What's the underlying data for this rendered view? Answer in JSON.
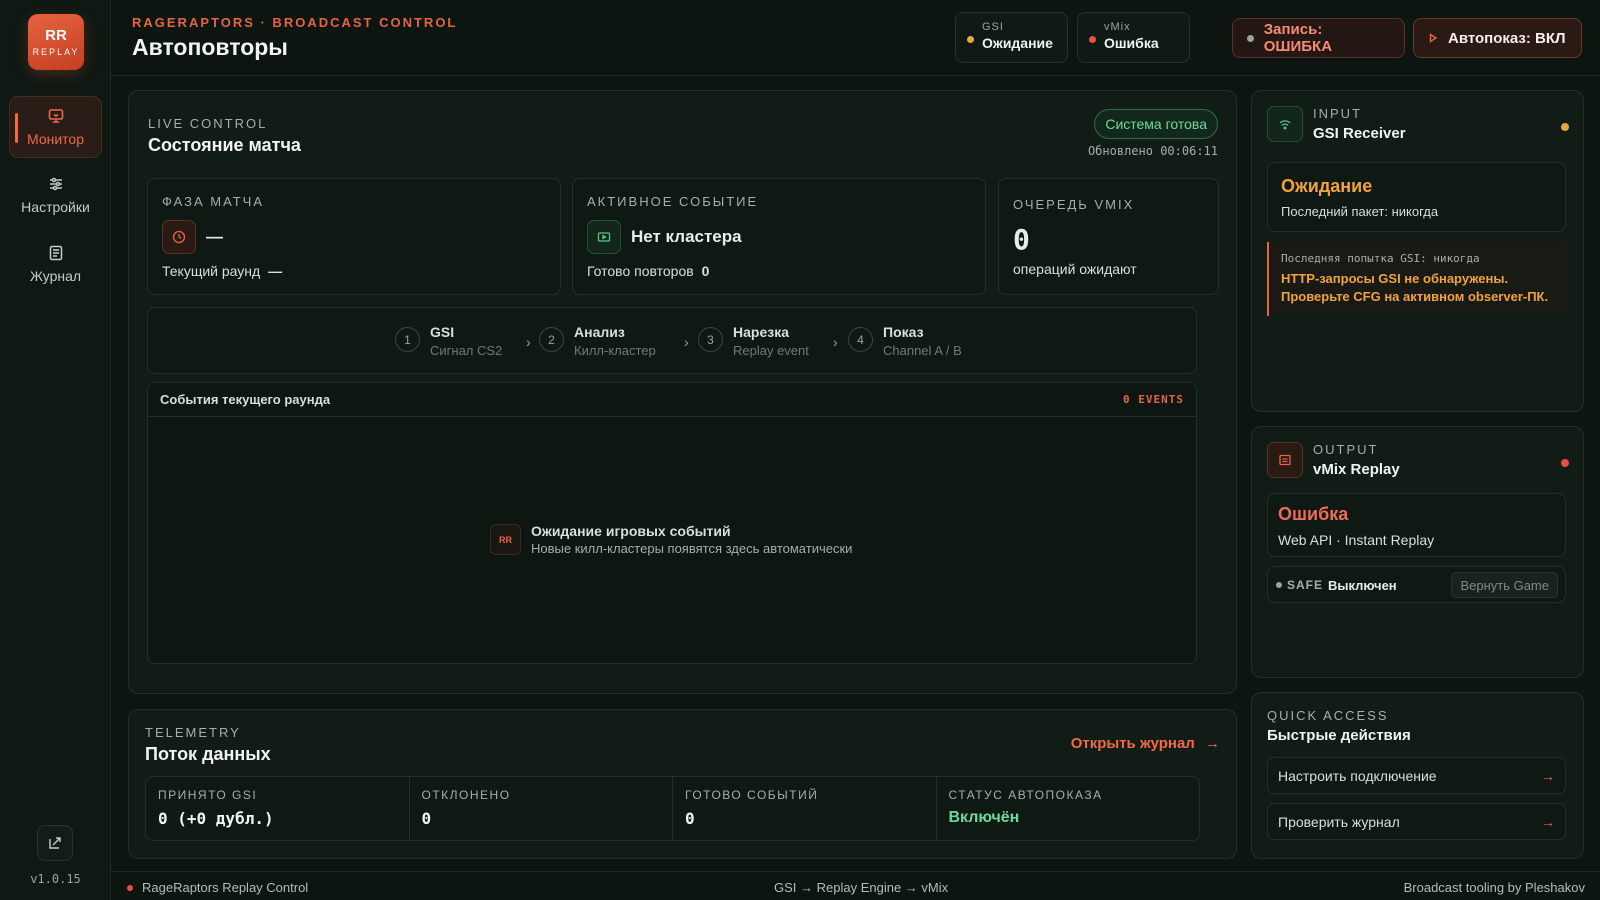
{
  "sidebar": {
    "logo_top": "RR",
    "logo_bottom": "REPLAY",
    "items": [
      {
        "label": "Монитор",
        "icon": "monitor-icon"
      },
      {
        "label": "Настройки",
        "icon": "sliders-icon"
      },
      {
        "label": "Журнал",
        "icon": "journal-icon"
      }
    ],
    "version": "v1.0.15"
  },
  "header": {
    "brand": "RAGERAPTORS · BROADCAST CONTROL",
    "title": "Автоповторы",
    "gsi": {
      "label": "GSI",
      "value": "Ожидание",
      "color": "#e8a840"
    },
    "vmix": {
      "label": "vMix",
      "value": "Ошибка",
      "color": "#e8503f"
    },
    "record_button": "Запись: ОШИБКА",
    "autoplay_button": "Автопоказ: ВКЛ"
  },
  "live": {
    "eyebrow": "LIVE CONTROL",
    "title": "Состояние матча",
    "badge": "Система готова",
    "updated": "Обновлено 00:06:11",
    "phase": {
      "label": "ФАЗА МАТЧА",
      "value": "—",
      "round_label": "Текущий раунд",
      "round_value": "—"
    },
    "active_event": {
      "label": "АКТИВНОЕ СОБЫТИЕ",
      "value": "Нет кластера",
      "ready_label": "Готово повторов",
      "ready_value": "0"
    },
    "queue": {
      "label": "ОЧЕРЕДЬ VMIX",
      "value": "0",
      "sub": "операций ожидают"
    },
    "pipeline": [
      {
        "num": "1",
        "title": "GSI",
        "sub": "Сигнал CS2"
      },
      {
        "num": "2",
        "title": "Анализ",
        "sub": "Килл-кластер"
      },
      {
        "num": "3",
        "title": "Нарезка",
        "sub": "Replay event"
      },
      {
        "num": "4",
        "title": "Показ",
        "sub": "Channel A / B"
      }
    ],
    "arrow": "›",
    "events": {
      "title": "События текущего раунда",
      "count": "0 EVENTS",
      "empty_badge": "RR",
      "empty_title": "Ожидание игровых событий",
      "empty_sub": "Новые килл-кластеры появятся здесь автоматически"
    }
  },
  "telemetry": {
    "eyebrow": "TELEMETRY",
    "title": "Поток данных",
    "open_log": "Открыть журнал",
    "metrics": [
      {
        "label": "ПРИНЯТО GSI",
        "value": "0 (+0 дубл.)"
      },
      {
        "label": "ОТКЛОНЕНО",
        "value": "0"
      },
      {
        "label": "ГОТОВО СОБЫТИЙ",
        "value": "0"
      },
      {
        "label": "СТАТУС АВТОПОКАЗА",
        "value": "Включён"
      }
    ]
  },
  "input": {
    "eyebrow": "INPUT",
    "title": "GSI Receiver",
    "state": "Ожидание",
    "last_packet": "Последний пакет: никогда",
    "alert_head": "Последняя попытка GSI: никогда",
    "alert_line1": "HTTP-запросы GSI не обнаружены.",
    "alert_line2": "Проверьте CFG на активном observer-ПК."
  },
  "output": {
    "eyebrow": "OUTPUT",
    "title": "vMix Replay",
    "state": "Ошибка",
    "sub": "Web API · Instant Replay",
    "safe_label": "SAFE",
    "safe_value": "Выключен",
    "safe_button": "Вернуть Game"
  },
  "quick": {
    "eyebrow": "QUICK ACCESS",
    "title": "Быстрые действия",
    "items": [
      "Настроить подключение",
      "Проверить журнал"
    ]
  },
  "footer": {
    "left": "RageRaptors Replay Control",
    "center": "GSI → Replay Engine → vMix",
    "right": "Broadcast tooling by Pleshakov"
  }
}
